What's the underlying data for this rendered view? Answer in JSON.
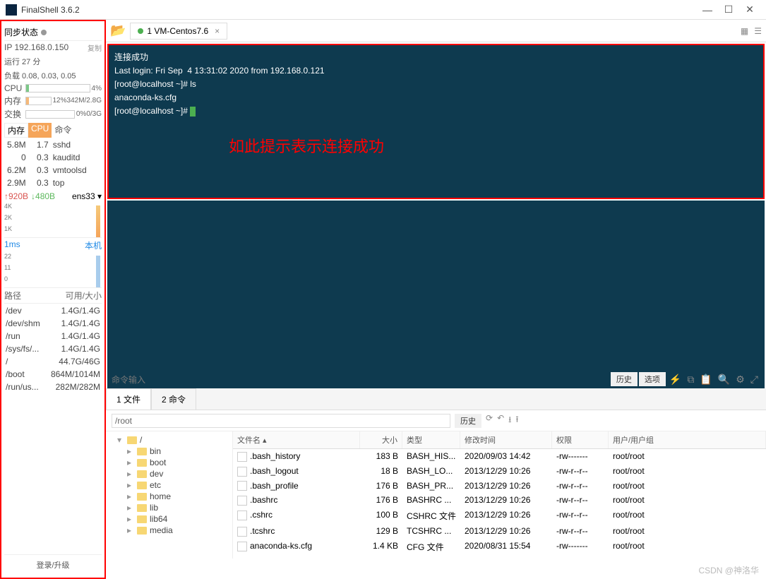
{
  "window": {
    "title": "FinalShell 3.6.2"
  },
  "sidebar": {
    "sync": "同步状态",
    "ip_label": "IP 192.168.0.150",
    "copy": "复制",
    "uptime": "运行 27 分",
    "load": "负载 0.08, 0.03, 0.05",
    "cpu_label": "CPU",
    "cpu_pct": "4%",
    "mem_label": "内存",
    "mem_pct": "12%",
    "mem_val": "342M/2.8G",
    "swap_label": "交换",
    "swap_pct": "0%",
    "swap_val": "0/3G",
    "proc_hdr": {
      "mem": "内存",
      "cpu": "CPU",
      "cmd": "命令"
    },
    "procs": [
      {
        "mem": "5.8M",
        "cpu": "1.7",
        "cmd": "sshd"
      },
      {
        "mem": "0",
        "cpu": "0.3",
        "cmd": "kauditd"
      },
      {
        "mem": "6.2M",
        "cpu": "0.3",
        "cmd": "vmtoolsd"
      },
      {
        "mem": "2.9M",
        "cpu": "0.3",
        "cmd": "top"
      }
    ],
    "net_up": "↑920B",
    "net_dn": "↓480B",
    "iface": "ens33 ▾",
    "g1": {
      "t1": "4K",
      "t2": "2K",
      "t3": "1K"
    },
    "latency": "1ms",
    "local": "本机",
    "g2": {
      "t1": "22",
      "t2": "11",
      "t3": "0"
    },
    "fs_hdr": {
      "path": "路径",
      "size": "可用/大小"
    },
    "fs": [
      {
        "path": "/dev",
        "size": "1.4G/1.4G"
      },
      {
        "path": "/dev/shm",
        "size": "1.4G/1.4G"
      },
      {
        "path": "/run",
        "size": "1.4G/1.4G"
      },
      {
        "path": "/sys/fs/...",
        "size": "1.4G/1.4G"
      },
      {
        "path": "/",
        "size": "44.7G/46G"
      },
      {
        "path": "/boot",
        "size": "864M/1014M"
      },
      {
        "path": "/run/us...",
        "size": "282M/282M"
      }
    ],
    "login": "登录/升级"
  },
  "tab": {
    "label": "1 VM-Centos7.6"
  },
  "terminal": {
    "l1": "连接成功",
    "l2": "Last login: Fri Sep  4 13:31:02 2020 from 192.168.0.121",
    "l3": "[root@localhost ~]# ls",
    "l4": "anaconda-ks.cfg",
    "l5": "[root@localhost ~]# ",
    "annot": "如此提示表示连接成功"
  },
  "cmdbar": {
    "placeholder": "命令输入",
    "history": "历史",
    "options": "选项"
  },
  "panel": {
    "tab1": "1 文件",
    "tab2": "2 命令",
    "path": "/root",
    "hist": "历史"
  },
  "tree": [
    "/",
    "bin",
    "boot",
    "dev",
    "etc",
    "home",
    "lib",
    "lib64",
    "media"
  ],
  "filehdr": {
    "name": "文件名 ▴",
    "size": "大小",
    "type": "类型",
    "date": "修改时间",
    "perm": "权限",
    "own": "用户/用户组"
  },
  "files": [
    {
      "name": ".bash_history",
      "size": "183 B",
      "type": "BASH_HIS...",
      "date": "2020/09/03 14:42",
      "perm": "-rw-------",
      "own": "root/root"
    },
    {
      "name": ".bash_logout",
      "size": "18 B",
      "type": "BASH_LO...",
      "date": "2013/12/29 10:26",
      "perm": "-rw-r--r--",
      "own": "root/root"
    },
    {
      "name": ".bash_profile",
      "size": "176 B",
      "type": "BASH_PR...",
      "date": "2013/12/29 10:26",
      "perm": "-rw-r--r--",
      "own": "root/root"
    },
    {
      "name": ".bashrc",
      "size": "176 B",
      "type": "BASHRC ...",
      "date": "2013/12/29 10:26",
      "perm": "-rw-r--r--",
      "own": "root/root"
    },
    {
      "name": ".cshrc",
      "size": "100 B",
      "type": "CSHRC 文件",
      "date": "2013/12/29 10:26",
      "perm": "-rw-r--r--",
      "own": "root/root"
    },
    {
      "name": ".tcshrc",
      "size": "129 B",
      "type": "TCSHRC ...",
      "date": "2013/12/29 10:26",
      "perm": "-rw-r--r--",
      "own": "root/root"
    },
    {
      "name": "anaconda-ks.cfg",
      "size": "1.4 KB",
      "type": "CFG 文件",
      "date": "2020/08/31 15:54",
      "perm": "-rw-------",
      "own": "root/root"
    }
  ],
  "watermark": "CSDN @神洛华"
}
